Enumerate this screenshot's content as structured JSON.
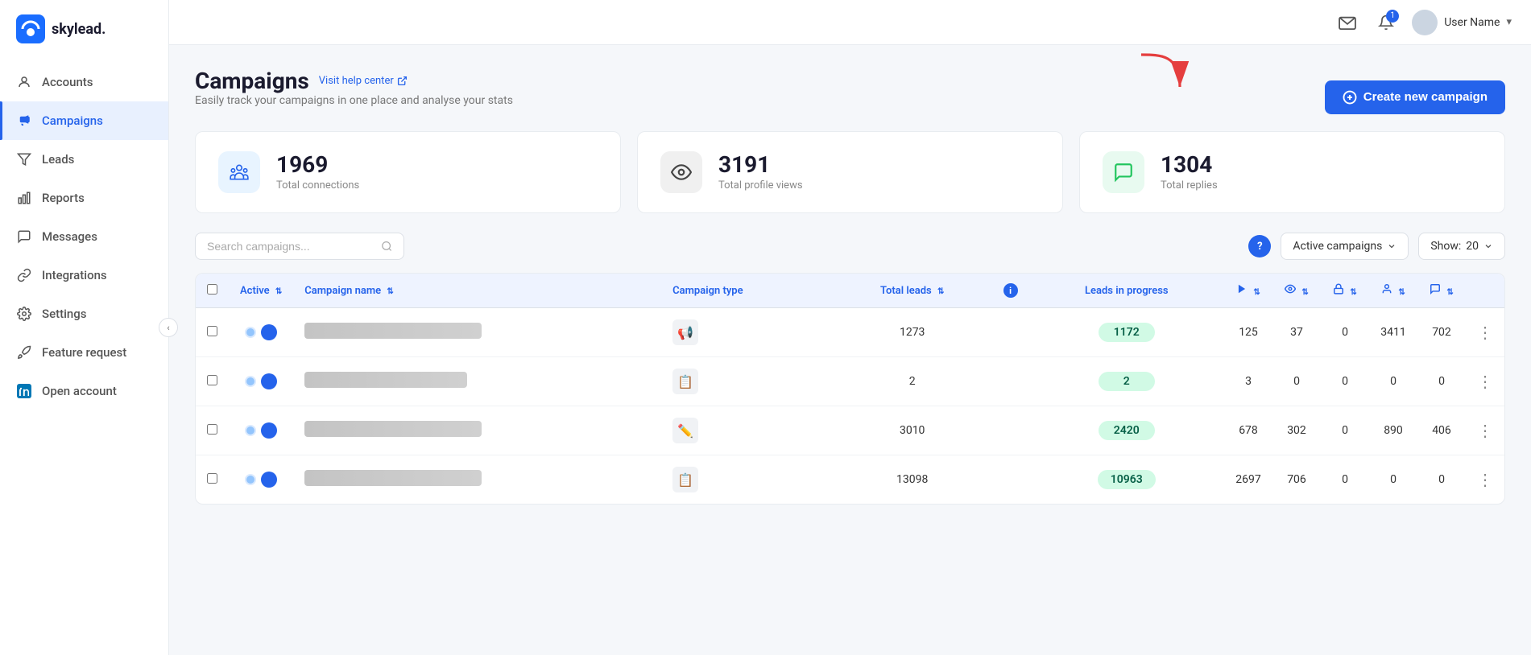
{
  "app": {
    "name": "skylead",
    "logo_text": "skylead."
  },
  "sidebar": {
    "items": [
      {
        "id": "accounts",
        "label": "Accounts",
        "icon": "person"
      },
      {
        "id": "campaigns",
        "label": "Campaigns",
        "icon": "megaphone",
        "active": true
      },
      {
        "id": "leads",
        "label": "Leads",
        "icon": "filter"
      },
      {
        "id": "reports",
        "label": "Reports",
        "icon": "bar-chart"
      },
      {
        "id": "messages",
        "label": "Messages",
        "icon": "chat"
      },
      {
        "id": "integrations",
        "label": "Integrations",
        "icon": "link"
      },
      {
        "id": "settings",
        "label": "Settings",
        "icon": "gear"
      },
      {
        "id": "feature-request",
        "label": "Feature request",
        "icon": "rocket"
      },
      {
        "id": "open-account",
        "label": "Open account",
        "icon": "linkedin"
      }
    ]
  },
  "topbar": {
    "mail_icon": "✉",
    "notification_count": "1",
    "user_name": "User Name",
    "dropdown_icon": "▾"
  },
  "page": {
    "title": "Campaigns",
    "help_link_label": "Visit help center",
    "subtitle": "Easily track your campaigns in one place and analyse your stats",
    "create_btn_label": "Create new campaign"
  },
  "stats": [
    {
      "id": "connections",
      "number": "1969",
      "label": "Total connections",
      "icon_type": "blue",
      "icon": "🔗"
    },
    {
      "id": "profile-views",
      "number": "3191",
      "label": "Total profile views",
      "icon_type": "dark",
      "icon": "👁"
    },
    {
      "id": "replies",
      "number": "1304",
      "label": "Total replies",
      "icon_type": "green",
      "icon": "💬"
    }
  ],
  "filters": {
    "search_placeholder": "Search campaigns...",
    "filter_label": "Active campaigns",
    "show_label": "Show:",
    "show_value": "20"
  },
  "table": {
    "headers": [
      {
        "id": "checkbox",
        "label": ""
      },
      {
        "id": "active",
        "label": "Active",
        "sortable": true
      },
      {
        "id": "campaign-name",
        "label": "Campaign name",
        "sortable": true
      },
      {
        "id": "campaign-type",
        "label": "Campaign type"
      },
      {
        "id": "total-leads",
        "label": "Total leads",
        "sortable": true
      },
      {
        "id": "info",
        "label": ""
      },
      {
        "id": "leads-in-progress",
        "label": "Leads in progress"
      },
      {
        "id": "col7",
        "label": "▶",
        "sortable": true
      },
      {
        "id": "col8",
        "label": "👁",
        "sortable": true
      },
      {
        "id": "col9",
        "label": "🔒",
        "sortable": true
      },
      {
        "id": "col10",
        "label": "👤",
        "sortable": true
      },
      {
        "id": "col11",
        "label": "💬",
        "sortable": true
      },
      {
        "id": "actions",
        "label": "⋮"
      }
    ],
    "rows": [
      {
        "id": 1,
        "active": true,
        "name": "██████ ██████████ ████████",
        "type_icon": "📢",
        "total_leads": "1273",
        "leads_progress": "1172",
        "c7": "125",
        "c8": "37",
        "c9": "0",
        "c10": "3411",
        "c11": "702"
      },
      {
        "id": 2,
        "active": true,
        "name": "████████ ████ ██████ ██",
        "type_icon": "📋",
        "total_leads": "2",
        "leads_progress": "2",
        "c7": "3",
        "c8": "0",
        "c9": "0",
        "c10": "0",
        "c11": "0"
      },
      {
        "id": 3,
        "active": true,
        "name": "████ █████ ███ ████ ████████",
        "type_icon": "✏️",
        "total_leads": "3010",
        "leads_progress": "2420",
        "c7": "678",
        "c8": "302",
        "c9": "0",
        "c10": "890",
        "c11": "406"
      },
      {
        "id": 4,
        "active": true,
        "name": "█████████ ████████ ██████ ██",
        "type_icon": "📋",
        "total_leads": "13098",
        "leads_progress": "10963",
        "c7": "2697",
        "c8": "706",
        "c9": "0",
        "c10": "0",
        "c11": "0"
      }
    ]
  }
}
